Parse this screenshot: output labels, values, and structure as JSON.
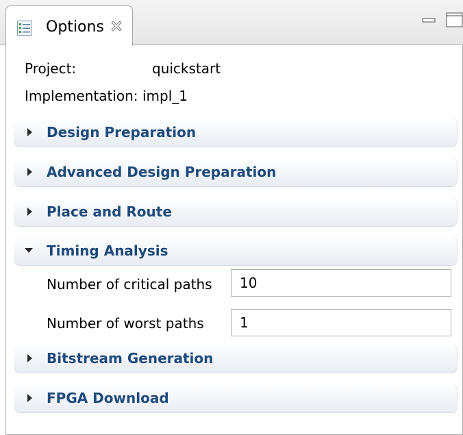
{
  "view": {
    "tab_label": "Options",
    "icons": {
      "tab": "options-list-icon",
      "close": "close-icon",
      "minimize": "minimize-icon",
      "maximize": "maximize-icon"
    }
  },
  "info": {
    "project_label": "Project:",
    "project_value": "quickstart",
    "implementation_label": "Implementation:",
    "implementation_value": "impl_1"
  },
  "sections": [
    {
      "label": "Design Preparation",
      "expanded": false
    },
    {
      "label": "Advanced Design Preparation",
      "expanded": false
    },
    {
      "label": "Place and Route",
      "expanded": false
    },
    {
      "label": "Timing Analysis",
      "expanded": true
    },
    {
      "label": "Bitstream Generation",
      "expanded": false
    },
    {
      "label": "FPGA Download",
      "expanded": false
    }
  ],
  "timing_analysis": {
    "critical_paths_label": "Number of critical paths",
    "critical_paths_value": "10",
    "worst_paths_label": "Number of worst paths",
    "worst_paths_value": "1"
  },
  "colors": {
    "section_text": "#1f4a7c",
    "border": "#a9a9a9"
  }
}
